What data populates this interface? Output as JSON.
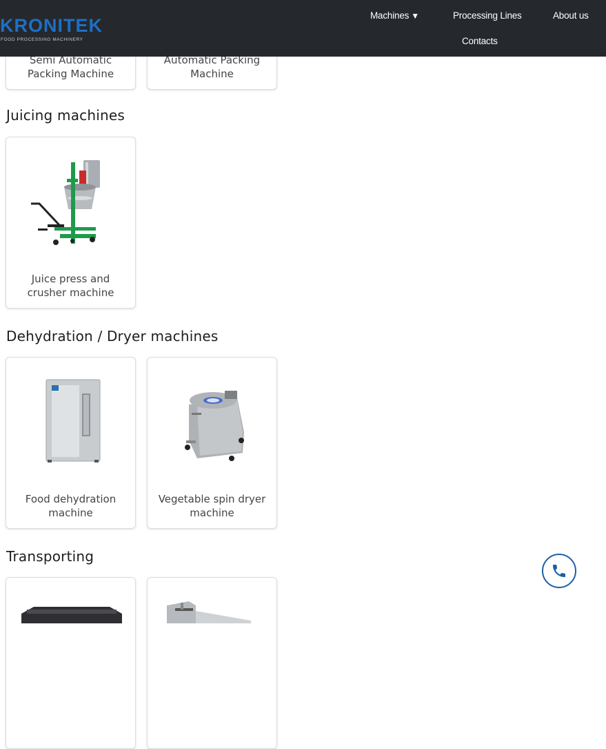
{
  "header": {
    "logo_text": "KRONITEK",
    "logo_tagline": "FOOD PROCESSING MACHINERY",
    "nav": {
      "machines": "Machines",
      "processing_lines": "Processing Lines",
      "about": "About us",
      "contacts": "Contacts"
    }
  },
  "packing": {
    "cards": [
      {
        "label": "Semi Automatic Packing Machine"
      },
      {
        "label": "Automatic Packing Machine"
      }
    ]
  },
  "juicing": {
    "title": "Juicing machines",
    "cards": [
      {
        "label": "Juice press and crusher machine"
      }
    ]
  },
  "dehydration": {
    "title": "Dehydration / Dryer machines",
    "cards": [
      {
        "label": "Food dehydration machine"
      },
      {
        "label": "Vegetable spin dryer machine"
      }
    ]
  },
  "transporting": {
    "title": "Transporting"
  },
  "icons": {
    "call": "phone-icon",
    "dropdown": "caret-down-icon"
  },
  "colors": {
    "header_bg": "#25282c",
    "brand_blue": "#1f6fc4",
    "machine_green": "#1f9a4a",
    "call_blue": "#1b5fa6"
  }
}
